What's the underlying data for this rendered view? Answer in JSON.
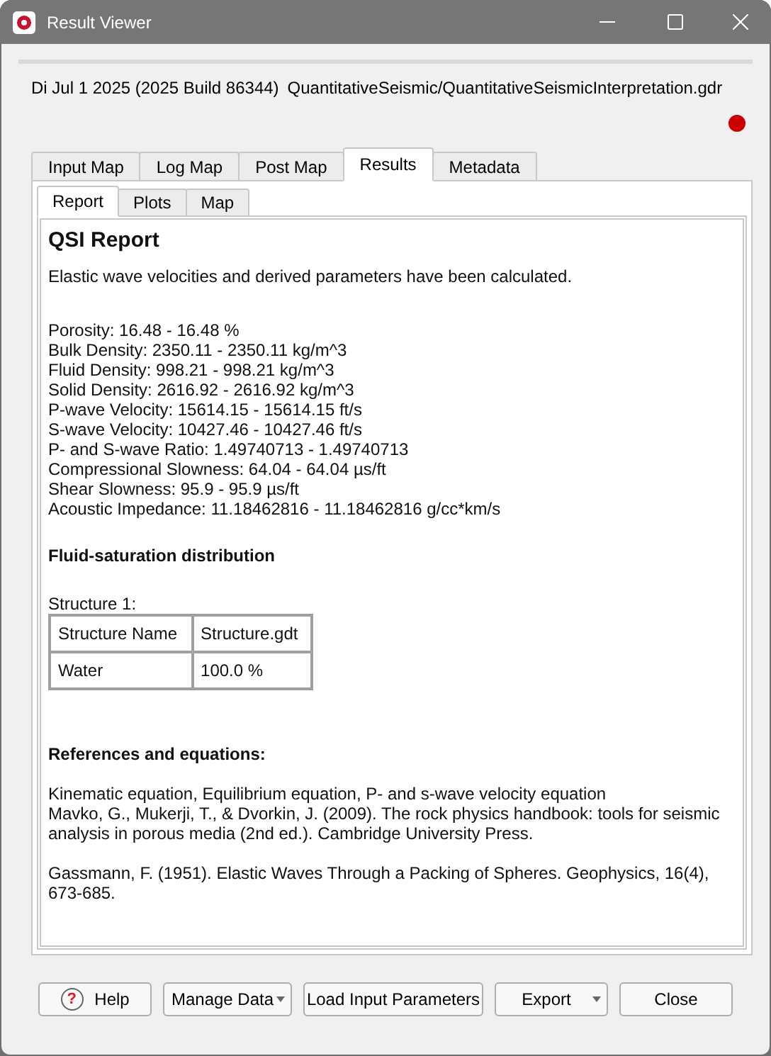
{
  "window": {
    "title": "Result Viewer"
  },
  "header": {
    "info": "Di Jul 1 2025 (2025 Build 86344)",
    "path": "QuantitativeSeismic/QuantitativeSeismicInterpretation.gdr",
    "indicator_on": true
  },
  "tabs": [
    {
      "label": "Input Map",
      "selected": false
    },
    {
      "label": "Log Map",
      "selected": false
    },
    {
      "label": "Post Map",
      "selected": false
    },
    {
      "label": "Results",
      "selected": true
    },
    {
      "label": "Metadata",
      "selected": false
    }
  ],
  "subtabs": [
    {
      "label": "Report",
      "selected": true
    },
    {
      "label": "Plots",
      "selected": false
    },
    {
      "label": "Map",
      "selected": false
    }
  ],
  "report": {
    "title": "QSI Report",
    "intro": "Elastic wave velocities and derived parameters have been calculated.",
    "parameters": [
      "Porosity: 16.48 - 16.48 %",
      "Bulk Density: 2350.11 - 2350.11 kg/m^3",
      "Fluid Density: 998.21 - 998.21 kg/m^3",
      "Solid Density: 2616.92 - 2616.92 kg/m^3",
      "P-wave Velocity: 15614.15 - 15614.15 ft/s",
      "S-wave Velocity: 10427.46 - 10427.46 ft/s",
      "P- and S-wave Ratio: 1.49740713 - 1.49740713",
      "Compressional Slowness: 64.04 - 64.04 µs/ft",
      "Shear Slowness: 95.9 - 95.9 µs/ft",
      "Acoustic Impedance: 11.18462816 - 11.18462816 g/cc*km/s"
    ],
    "fluid_heading": "Fluid-saturation distribution",
    "structure_label": "Structure 1:",
    "table": [
      [
        "Structure Name",
        "Structure.gdt"
      ],
      [
        "Water",
        "100.0 %"
      ]
    ],
    "references_heading": "References and equations:",
    "references": [
      "Kinematic equation, Equilibrium equation, P- and s-wave velocity equation\nMavko, G., Mukerji, T., & Dvorkin, J. (2009). The rock physics handbook: tools for seismic analysis in porous media (2nd ed.). Cambridge University Press.",
      "Gassmann, F. (1951). Elastic Waves Through a Packing of Spheres. Geophysics, 16(4), 673-685."
    ]
  },
  "buttons": [
    {
      "label": "Help",
      "kind": "help",
      "icon_glyph": "?"
    },
    {
      "label": "Manage Data",
      "kind": "dropdown"
    },
    {
      "label": "Load Input Parameters",
      "kind": "plain"
    },
    {
      "label": "Export",
      "kind": "dropdown"
    },
    {
      "label": "Close",
      "kind": "plain"
    }
  ]
}
